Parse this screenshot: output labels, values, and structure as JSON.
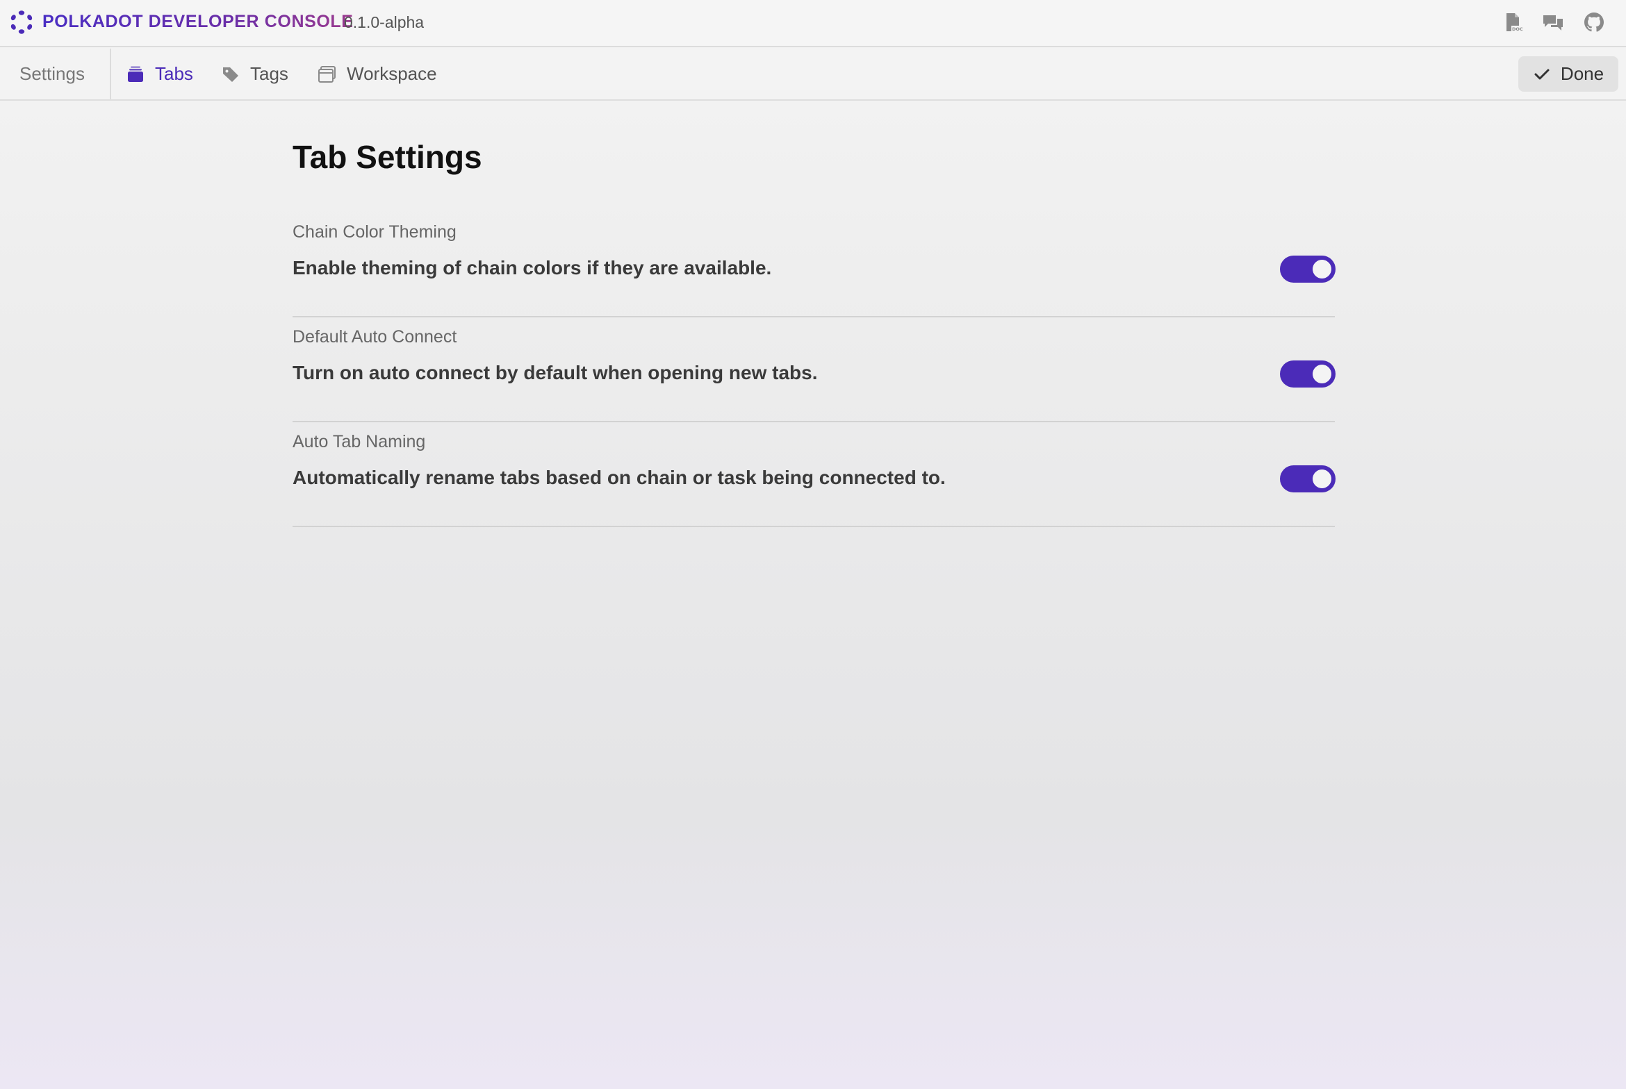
{
  "app": {
    "title": "POLKADOT DEVELOPER CONSOLE",
    "version": "0.1.0-alpha",
    "brand_color": "#4b2bb8"
  },
  "titlebar_icons": [
    "docs-icon",
    "chat-icon",
    "github-icon"
  ],
  "nav": {
    "section_label": "Settings",
    "tabs": [
      {
        "label": "Tabs",
        "icon": "tabs-icon",
        "active": true
      },
      {
        "label": "Tags",
        "icon": "tag-icon",
        "active": false
      },
      {
        "label": "Workspace",
        "icon": "workspace-icon",
        "active": false
      }
    ],
    "done_label": "Done"
  },
  "page": {
    "title": "Tab Settings",
    "settings": [
      {
        "label": "Chain Color Theming",
        "description": "Enable theming of chain colors if they are available.",
        "enabled": true
      },
      {
        "label": "Default Auto Connect",
        "description": "Turn on auto connect by default when opening new tabs.",
        "enabled": true
      },
      {
        "label": "Auto Tab Naming",
        "description": "Automatically rename tabs based on chain or task being connected to.",
        "enabled": true
      }
    ]
  }
}
